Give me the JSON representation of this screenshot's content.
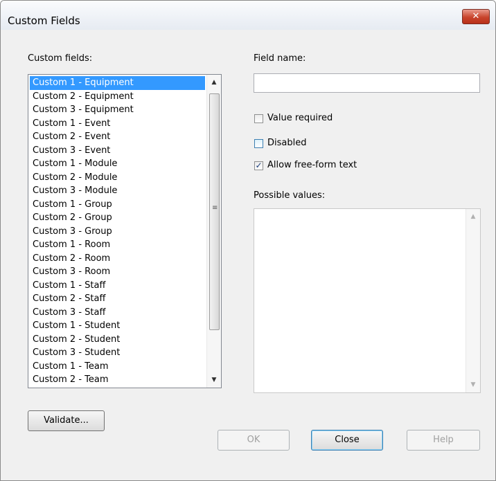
{
  "window": {
    "title": "Custom Fields",
    "close_glyph": "✕"
  },
  "labels": {
    "custom_fields": "Custom fields:",
    "field_name": "Field name:",
    "possible_values": "Possible values:"
  },
  "custom_fields_list": {
    "selected_index": 0,
    "items": [
      "Custom 1 - Equipment",
      "Custom 2 - Equipment",
      "Custom 3 - Equipment",
      "Custom 1 - Event",
      "Custom 2 - Event",
      "Custom 3 - Event",
      "Custom 1 - Module",
      "Custom 2 - Module",
      "Custom 3 - Module",
      "Custom 1 - Group",
      "Custom 2 - Group",
      "Custom 3 - Group",
      "Custom 1 - Room",
      "Custom 2 - Room",
      "Custom 3 - Room",
      "Custom 1 - Staff",
      "Custom 2 - Staff",
      "Custom 3 - Staff",
      "Custom 1 - Student",
      "Custom 2 - Student",
      "Custom 3 - Student",
      "Custom 1 - Team",
      "Custom 2 - Team"
    ]
  },
  "field_name": {
    "value": ""
  },
  "checkboxes": {
    "value_required": {
      "label": "Value required",
      "checked": false
    },
    "disabled": {
      "label": "Disabled",
      "checked": false
    },
    "allow_free_form": {
      "label": "Allow free-form text",
      "checked": true,
      "mark": "✓"
    }
  },
  "possible_values": {
    "items": []
  },
  "buttons": {
    "validate": "Validate...",
    "ok": "OK",
    "close": "Close",
    "help": "Help"
  },
  "icons": {
    "scroll_up": "▲",
    "scroll_down": "▼",
    "scroll_grip": "≡"
  },
  "colors": {
    "selection": "#3399ff",
    "dialog_bg": "#f0f0f0",
    "close_button": "#c8442c"
  }
}
